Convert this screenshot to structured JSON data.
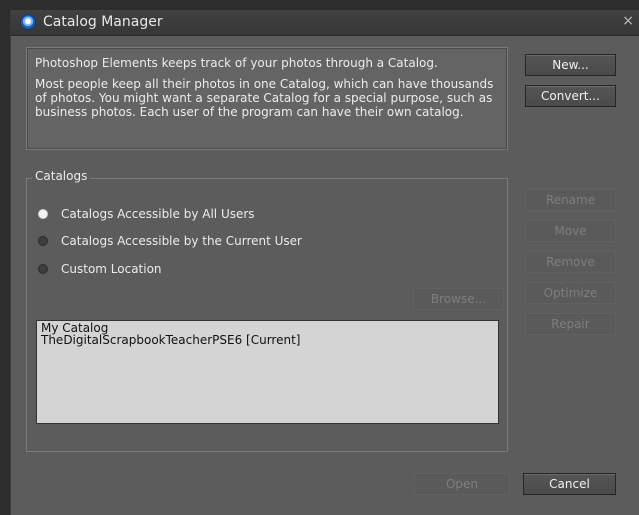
{
  "window": {
    "title": "Catalog Manager",
    "close_glyph": "×",
    "app_icon": "photoshop-elements-icon"
  },
  "info": {
    "line1": "Photoshop Elements keeps track of your photos through a Catalog.",
    "line2": "Most people keep all their photos in one Catalog, which can have thousands of photos. You might want a separate Catalog for a special purpose, such as business photos. Each user of the program can have their own catalog."
  },
  "top_buttons": {
    "new": "New...",
    "convert": "Convert..."
  },
  "catalogs": {
    "label": "Catalogs",
    "options": [
      {
        "label": "Catalogs Accessible by All Users",
        "checked": true
      },
      {
        "label": "Catalogs Accessible by the Current User",
        "checked": false
      },
      {
        "label": "Custom Location",
        "checked": false
      }
    ],
    "browse": "Browse...",
    "list": [
      "My Catalog",
      "TheDigitalScrapbookTeacherPSE6 [Current]"
    ]
  },
  "side_buttons": {
    "rename": "Rename",
    "move": "Move",
    "remove": "Remove",
    "optimize": "Optimize",
    "repair": "Repair"
  },
  "bottom_buttons": {
    "open": "Open",
    "cancel": "Cancel"
  },
  "colors": {
    "window_bg": "#5c5c5c",
    "titlebar_bg": "#3a3a3a",
    "list_bg": "#d4d4d4",
    "disabled_text": "#7e7e7e"
  }
}
